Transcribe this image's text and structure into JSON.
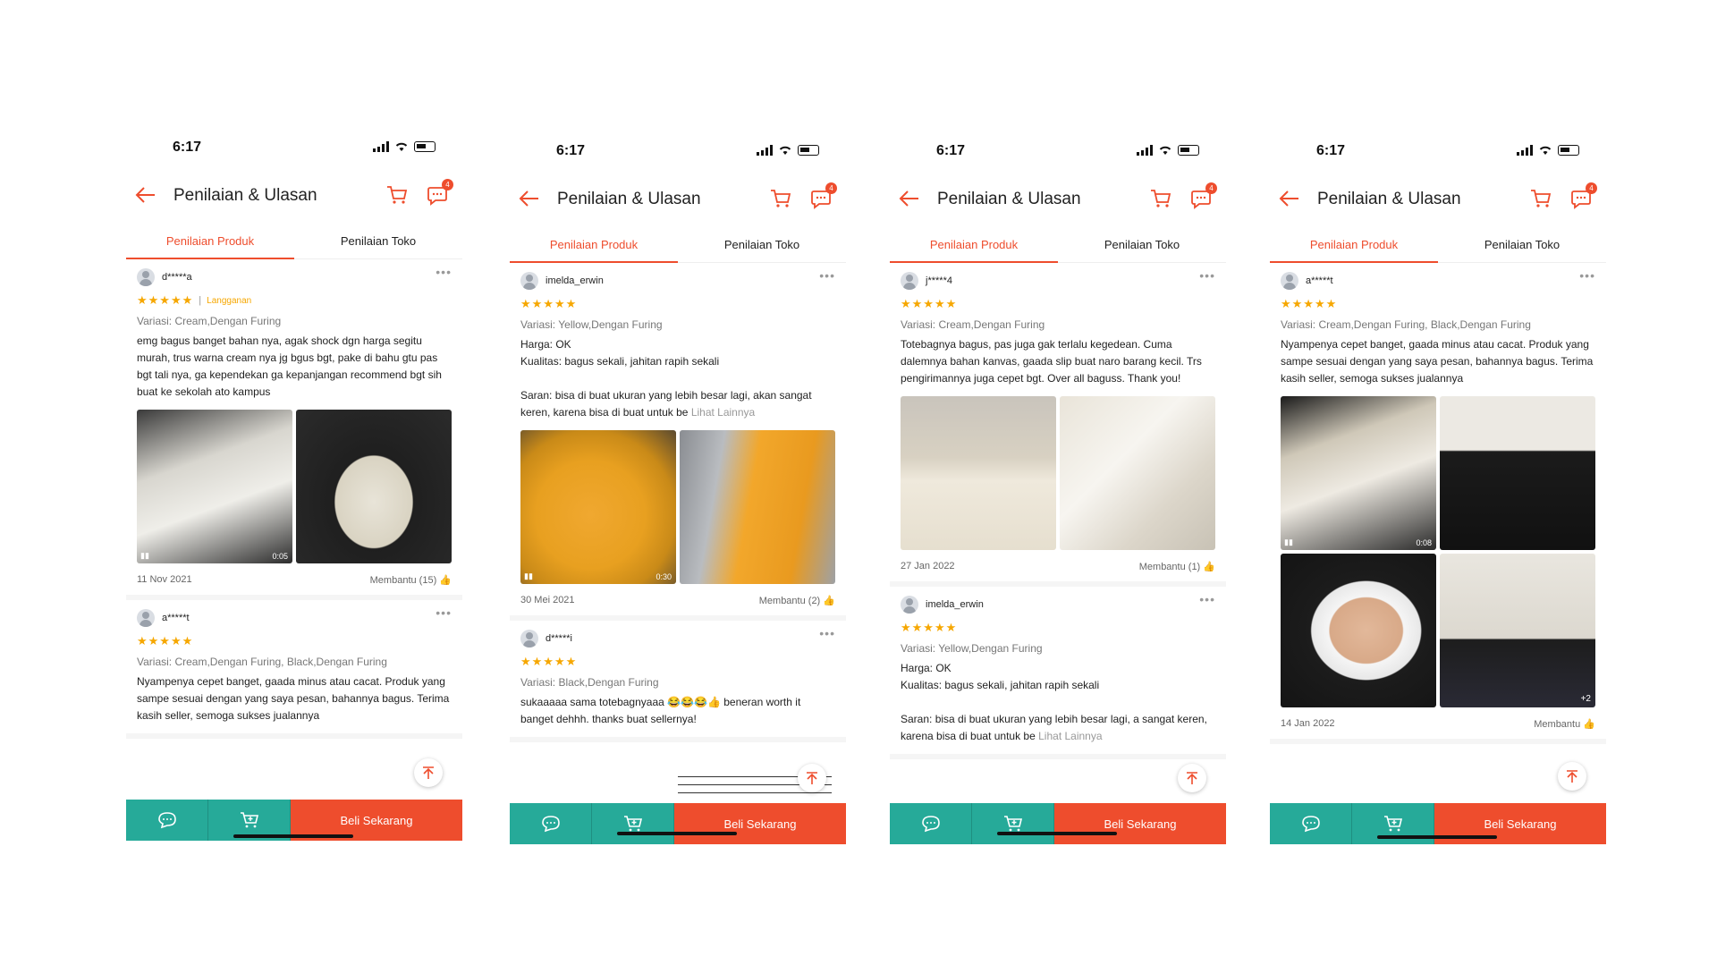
{
  "colors": {
    "accent": "#ee4d2d",
    "teal": "#26aa99",
    "star": "#f6a700"
  },
  "screens": [
    {
      "time": "6:17",
      "title": "Penilaian & Ulasan",
      "badge": "4",
      "tabs": [
        "Penilaian Produk",
        "Penilaian Toko"
      ],
      "buy_label": "Beli Sekarang",
      "reviews": [
        {
          "user": "d*****a",
          "stars": "★★★★★",
          "tag": "Langganan",
          "variasi": "Variasi: Cream,Dengan Furing",
          "text": "emg bagus banget bahan nya, agak shock dgn harga segitu murah, trus warna cream nya jg bgus bgt, pake di bahu gtu pas bgt tali nya, ga kependekan ga kepanjangan recommend bgt sih buat ke sekolah ato kampus",
          "video_duration": "0:05",
          "date": "11 Nov 2021",
          "helpful": "Membantu (15)"
        },
        {
          "user": "a*****t",
          "stars": "★★★★★",
          "variasi": "Variasi: Cream,Dengan Furing, Black,Dengan Furing",
          "text": "Nyampenya cepet banget, gaada minus atau cacat. Produk yang sampe sesuai dengan yang saya pesan, bahannya bagus. Terima kasih seller, semoga sukses jualannya"
        }
      ]
    },
    {
      "time": "6:17",
      "title": "Penilaian & Ulasan",
      "badge": "4",
      "tabs": [
        "Penilaian Produk",
        "Penilaian Toko"
      ],
      "buy_label": "Beli Sekarang",
      "reviews": [
        {
          "user": "imelda_erwin",
          "stars": "★★★★★",
          "variasi": "Variasi: Yellow,Dengan Furing",
          "line1": "Harga: OK",
          "line2": "Kualitas: bagus sekali, jahitan rapih sekali",
          "line3": "Saran: bisa di buat ukuran yang lebih besar lagi, akan sangat keren, karena bisa di buat untuk be",
          "see_more": "Lihat Lainnya",
          "video_duration": "0:30",
          "date": "30 Mei 2021",
          "helpful": "Membantu (2)"
        },
        {
          "user": "d*****i",
          "stars": "★★★★★",
          "variasi": "Variasi: Black,Dengan Furing",
          "text": "sukaaaaa sama totebagnyaaa 😂😂😂👍 beneran worth it banget dehhh. thanks buat sellernya!"
        }
      ]
    },
    {
      "time": "6:17",
      "title": "Penilaian & Ulasan",
      "badge": "4",
      "tabs": [
        "Penilaian Produk",
        "Penilaian Toko"
      ],
      "buy_label": "Beli Sekarang",
      "reviews": [
        {
          "user": "j*****4",
          "stars": "★★★★★",
          "variasi": "Variasi: Cream,Dengan Furing",
          "text": "Totebagnya bagus, pas juga gak terlalu kegedean. Cuma dalemnya bahan kanvas, gaada slip buat naro barang kecil. Trs pengirimannya juga cepet bgt. Over all baguss. Thank you!",
          "date": "27 Jan 2022",
          "helpful": "Membantu (1)"
        },
        {
          "user": "imelda_erwin",
          "stars": "★★★★★",
          "variasi": "Variasi: Yellow,Dengan Furing",
          "line1": "Harga: OK",
          "line2": "Kualitas: bagus sekali, jahitan rapih sekali",
          "line3": "Saran: bisa di buat ukuran yang lebih besar lagi, a sangat keren, karena bisa di buat untuk be",
          "see_more": "Lihat Lainnya"
        }
      ]
    },
    {
      "time": "6:17",
      "title": "Penilaian & Ulasan",
      "badge": "4",
      "tabs": [
        "Penilaian Produk",
        "Penilaian Toko"
      ],
      "buy_label": "Beli Sekarang",
      "reviews": [
        {
          "user": "a*****t",
          "stars": "★★★★★",
          "variasi": "Variasi: Cream,Dengan Furing, Black,Dengan Furing",
          "text": "Nyampenya cepet banget, gaada minus atau cacat. Produk yang sampe sesuai dengan yang saya pesan, bahannya bagus. Terima kasih seller, semoga sukses jualannya",
          "video_duration": "0:08",
          "more_photos": "+2",
          "date": "14 Jan 2022",
          "helpful": "Membantu"
        }
      ]
    }
  ]
}
